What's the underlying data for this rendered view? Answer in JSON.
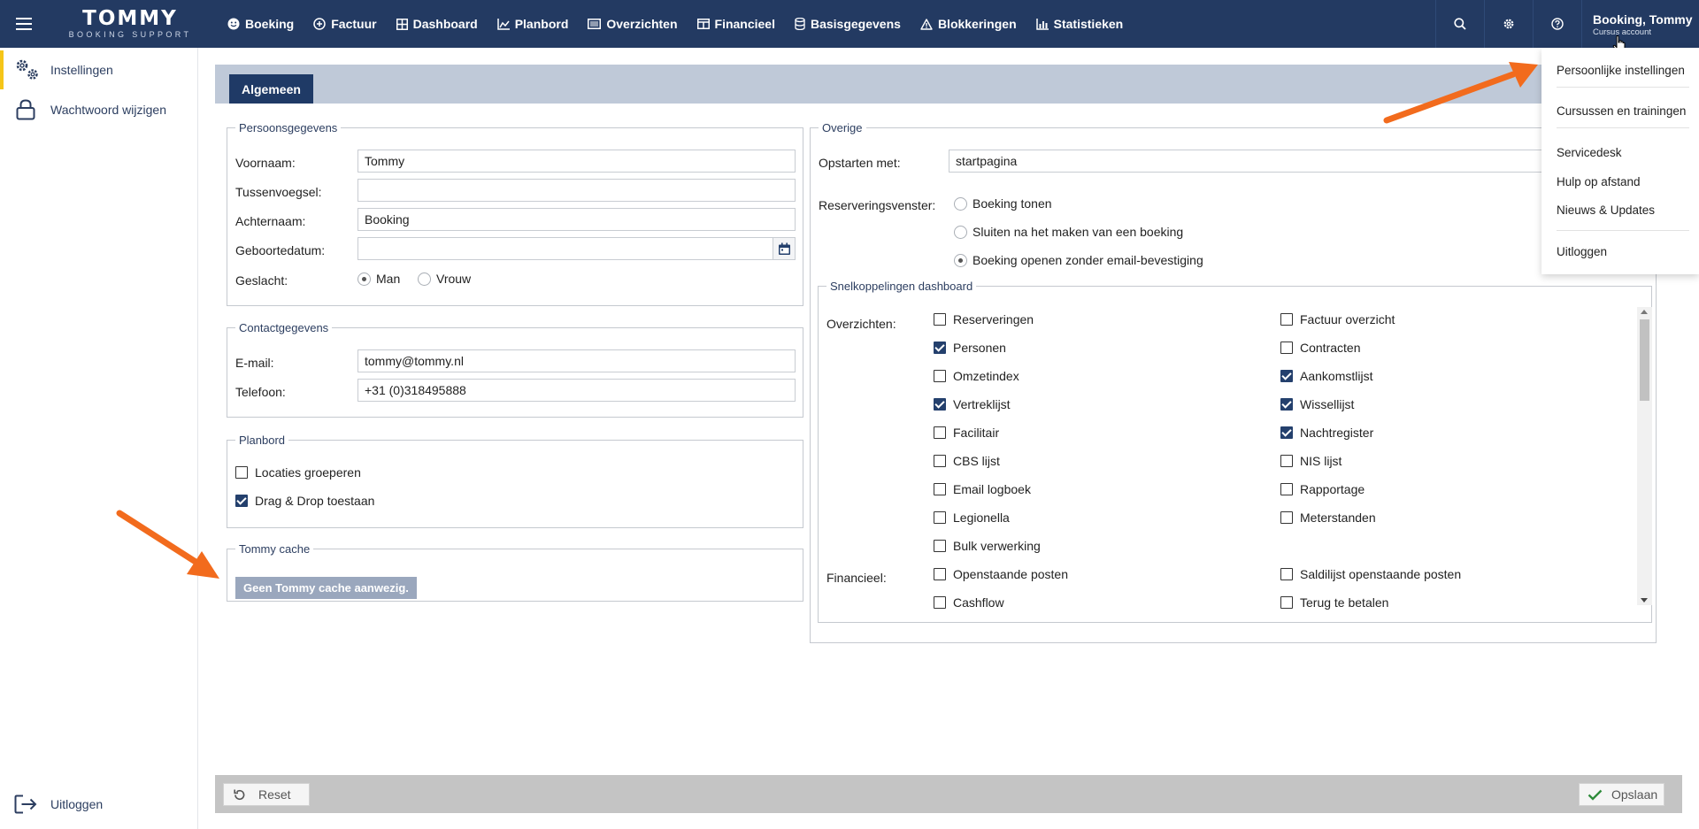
{
  "app": {
    "logo_main": "TOMMY",
    "logo_sub": "BOOKING SUPPORT"
  },
  "nav": {
    "items": [
      {
        "label": "Boeking",
        "icon": "smiley-icon"
      },
      {
        "label": "Factuur",
        "icon": "plus-circle-icon"
      },
      {
        "label": "Dashboard",
        "icon": "dashboard-grid-icon"
      },
      {
        "label": "Planbord",
        "icon": "area-chart-icon"
      },
      {
        "label": "Overzichten",
        "icon": "list-icon"
      },
      {
        "label": "Financieel",
        "icon": "table-icon"
      },
      {
        "label": "Basisgegevens",
        "icon": "database-icon"
      },
      {
        "label": "Blokkeringen",
        "icon": "warning-icon"
      },
      {
        "label": "Statistieken",
        "icon": "bar-chart-icon"
      }
    ]
  },
  "user": {
    "name": "Booking, Tommy",
    "account": "Cursus account"
  },
  "sidebar": {
    "items": [
      {
        "label": "Instellingen",
        "icon": "gears-icon"
      },
      {
        "label": "Wachtwoord wijzigen",
        "icon": "lock-icon"
      }
    ],
    "logout_label": "Uitloggen"
  },
  "tabs": [
    {
      "label": "Algemeen"
    }
  ],
  "personal": {
    "legend": "Persoonsgegevens",
    "voornaam_label": "Voornaam:",
    "voornaam_value": "Tommy",
    "tussenvoegsel_label": "Tussenvoegsel:",
    "tussenvoegsel_value": "",
    "achternaam_label": "Achternaam:",
    "achternaam_value": "Booking",
    "geboortedatum_label": "Geboortedatum:",
    "geboortedatum_value": "",
    "geslacht_label": "Geslacht:",
    "geslacht_options": [
      {
        "label": "Man",
        "checked": true
      },
      {
        "label": "Vrouw",
        "checked": false
      }
    ]
  },
  "contact": {
    "legend": "Contactgegevens",
    "email_label": "E-mail:",
    "email_value": "tommy@tommy.nl",
    "telefoon_label": "Telefoon:",
    "telefoon_value": "+31 (0)318495888"
  },
  "planbord": {
    "legend": "Planbord",
    "options": [
      {
        "label": "Locaties groeperen",
        "checked": false
      },
      {
        "label": "Drag & Drop toestaan",
        "checked": true
      }
    ]
  },
  "cache": {
    "legend": "Tommy cache",
    "button_label": "Geen Tommy cache aanwezig."
  },
  "overige": {
    "legend": "Overige",
    "opstarten_label": "Opstarten met:",
    "opstarten_value": "startpagina",
    "reservering_label": "Reserveringsvenster:",
    "reservering_options": [
      {
        "label": "Boeking tonen",
        "checked": false
      },
      {
        "label": "Sluiten na het maken van een boeking",
        "checked": false
      },
      {
        "label": "Boeking openen zonder email-bevestiging",
        "checked": true
      }
    ]
  },
  "shortcuts": {
    "legend": "Snelkoppelingen dashboard",
    "overzichten_label": "Overzichten:",
    "overzichten_left": [
      {
        "label": "Reserveringen",
        "checked": false
      },
      {
        "label": "Personen",
        "checked": true
      },
      {
        "label": "Omzetindex",
        "checked": false
      },
      {
        "label": "Vertreklijst",
        "checked": true
      },
      {
        "label": "Facilitair",
        "checked": false
      },
      {
        "label": "CBS lijst",
        "checked": false
      },
      {
        "label": "Email logboek",
        "checked": false
      },
      {
        "label": "Legionella",
        "checked": false
      },
      {
        "label": "Bulk verwerking",
        "checked": false
      }
    ],
    "overzichten_right": [
      {
        "label": "Factuur overzicht",
        "checked": false
      },
      {
        "label": "Contracten",
        "checked": false
      },
      {
        "label": "Aankomstlijst",
        "checked": true
      },
      {
        "label": "Wissellijst",
        "checked": true
      },
      {
        "label": "Nachtregister",
        "checked": true
      },
      {
        "label": "NIS lijst",
        "checked": false
      },
      {
        "label": "Rapportage",
        "checked": false
      },
      {
        "label": "Meterstanden",
        "checked": false
      }
    ],
    "financieel_label": "Financieel:",
    "financieel_left": [
      {
        "label": "Openstaande posten",
        "checked": false
      },
      {
        "label": "Cashflow",
        "checked": false
      }
    ],
    "financieel_right": [
      {
        "label": "Saldilijst openstaande posten",
        "checked": false
      },
      {
        "label": "Terug te betalen",
        "checked": false
      }
    ]
  },
  "footer": {
    "reset_label": "Reset",
    "save_label": "Opslaan"
  },
  "user_menu": {
    "items": [
      "Persoonlijke instellingen",
      "Cursussen en trainingen",
      "Servicedesk",
      "Hulp op afstand",
      "Nieuws & Updates",
      "Uitloggen"
    ]
  },
  "colors": {
    "header": "#233a62",
    "tab_active": "#1f3a66",
    "accent_yellow": "#f5c518",
    "annotation_arrow": "#f26b1d",
    "checkbox_checked": "#24406d"
  }
}
